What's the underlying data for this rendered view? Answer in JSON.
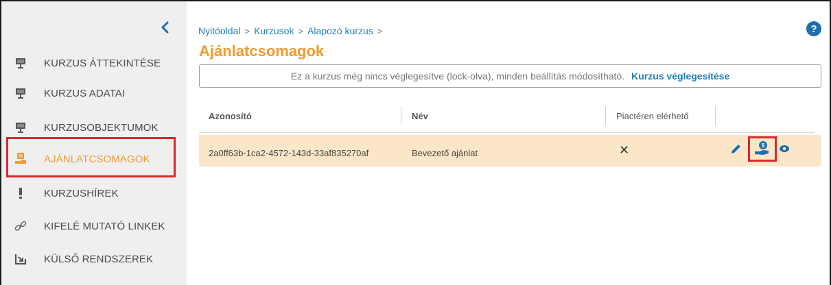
{
  "sidebar": {
    "items": [
      {
        "label": "KURZUS ÁTTEKINTÉSE",
        "icon": "presentation-icon"
      },
      {
        "label": "KURZUS ADATAI",
        "icon": "presentation-icon"
      },
      {
        "label": "KURZUSOBJEKTUMOK",
        "icon": "presentation-icon"
      },
      {
        "label": "AJÁNLATCSOMAGOK",
        "icon": "offer-hand-icon",
        "active": true
      },
      {
        "label": "KURZUSHÍREK",
        "icon": "exclamation-icon"
      },
      {
        "label": "KIFELÉ MUTATÓ LINKEK",
        "icon": "link-icon"
      },
      {
        "label": "KÜLSŐ RENDSZEREK",
        "icon": "export-icon"
      }
    ]
  },
  "breadcrumb": {
    "items": [
      "Nyitóoldal",
      "Kurzusok",
      "Alapozó kurzus"
    ],
    "separator": ">"
  },
  "help": {
    "label": "?"
  },
  "page_title": "Ajánlatcsomagok",
  "notice": {
    "text": "Ez a kurzus még nincs véglegesítve (lock-olva), minden beállítás módosítható.",
    "action": "Kurzus véglegesítése"
  },
  "table": {
    "columns": [
      "Azonosító",
      "Név",
      "Piactéren elérhető"
    ],
    "rows": [
      {
        "id": "2a0ff63b-1ca2-4572-143d-33af835270af",
        "name": "Bevezető ajánlat",
        "marketplace": "✕"
      }
    ]
  },
  "colors": {
    "accent_orange": "#f29a2e",
    "link_blue": "#1f7fb8",
    "highlight_red": "#d9282f",
    "row_bg": "#fbe6c8",
    "sidebar_bg": "#efefef"
  }
}
